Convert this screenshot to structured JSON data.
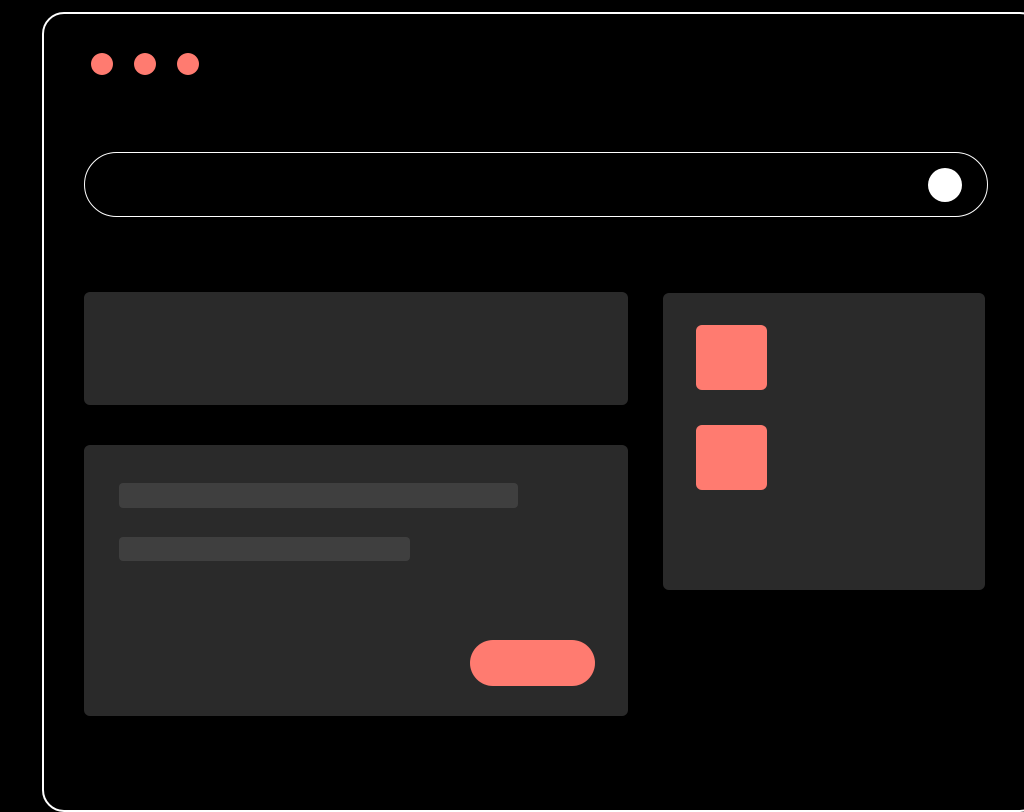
{
  "colors": {
    "background": "#000000",
    "window_border": "#ffffff",
    "accent": "#ff7b70",
    "panel": "#2a2a2a",
    "placeholder_bar": "#3f3f3f",
    "search_knob": "#ffffff"
  },
  "window_controls": [
    "dot",
    "dot",
    "dot"
  ],
  "search": {
    "placeholder": "",
    "value": ""
  },
  "icons": {
    "window_control": "circle-dot-icon",
    "search_action": "circle-button-icon"
  }
}
